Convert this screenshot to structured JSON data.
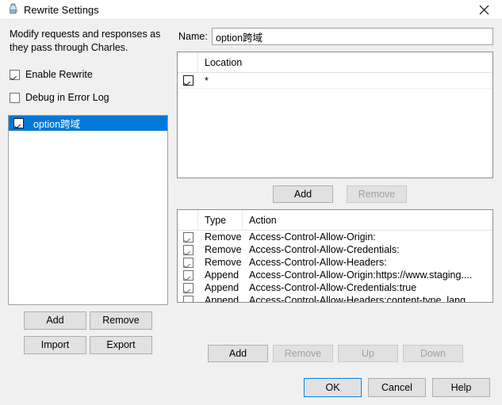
{
  "window": {
    "title": "Rewrite Settings",
    "app_icon": "charles-bottle-icon",
    "close_icon": "close-icon",
    "bg_color": "#f0f0f0",
    "titlebar_color": "#ffffff"
  },
  "colors": {
    "selection_blue": "#0078d7",
    "button_face": "#e1e1e1",
    "button_border": "#adadad",
    "disabled_text": "#a0a0a0"
  },
  "left_panel": {
    "description": "Modify requests and responses as they pass through Charles.",
    "checkboxes": [
      {
        "label": "Enable Rewrite",
        "checked": true
      },
      {
        "label": "Debug in Error Log",
        "checked": false
      }
    ],
    "rule_list": [
      {
        "label": "option跨域",
        "checked": true,
        "selected": true
      }
    ],
    "buttons": [
      {
        "label": "Add",
        "enabled": true
      },
      {
        "label": "Remove",
        "enabled": true
      },
      {
        "label": "Import",
        "enabled": true
      },
      {
        "label": "Export",
        "enabled": true
      }
    ]
  },
  "right_panel": {
    "name_label": "Name:",
    "name_value": "option跨域",
    "name_placeholder": "",
    "location_table": {
      "columns": [
        "",
        "Location"
      ],
      "rows": [
        {
          "checked": true,
          "location": "*"
        }
      ],
      "buttons": [
        {
          "label": "Add",
          "enabled": true
        },
        {
          "label": "Remove",
          "enabled": false
        }
      ]
    },
    "action_table": {
      "columns": [
        "",
        "Type",
        "Action"
      ],
      "rows": [
        {
          "checked": true,
          "type": "Remove",
          "action": "Access-Control-Allow-Origin:"
        },
        {
          "checked": true,
          "type": "Remove",
          "action": "Access-Control-Allow-Credentials:"
        },
        {
          "checked": true,
          "type": "Remove",
          "action": "Access-Control-Allow-Headers:"
        },
        {
          "checked": true,
          "type": "Append",
          "action": "Access-Control-Allow-Origin:https://www.staging...."
        },
        {
          "checked": true,
          "type": "Append",
          "action": "Access-Control-Allow-Credentials:true"
        },
        {
          "checked": true,
          "type": "Append",
          "action": "Access-Control-Allow-Headers:content-type, lang, ..."
        }
      ],
      "buttons": [
        {
          "label": "Add",
          "enabled": true
        },
        {
          "label": "Remove",
          "enabled": false
        },
        {
          "label": "Up",
          "enabled": false
        },
        {
          "label": "Down",
          "enabled": false
        }
      ]
    }
  },
  "dialog_buttons": [
    {
      "label": "OK",
      "default": true
    },
    {
      "label": "Cancel",
      "default": false
    },
    {
      "label": "Help",
      "default": false
    }
  ]
}
